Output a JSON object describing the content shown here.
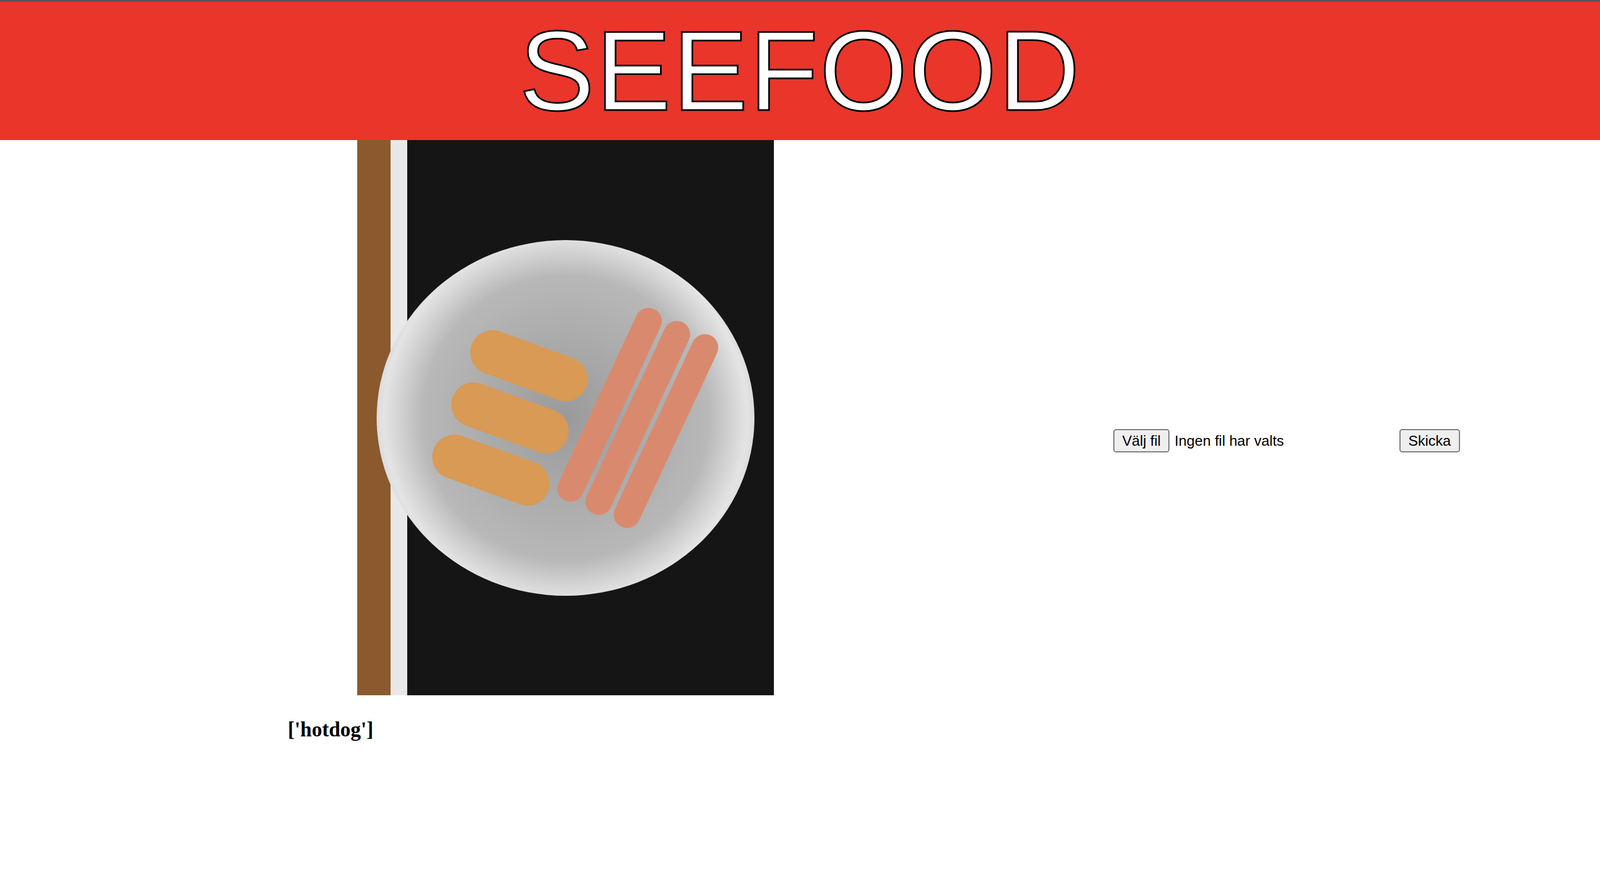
{
  "header": {
    "title": "SEEFOOD"
  },
  "upload": {
    "choose_button": "Välj fil",
    "file_status": "Ingen fil har valts",
    "submit_button": "Skicka"
  },
  "result": {
    "label": "['hotdog']"
  }
}
